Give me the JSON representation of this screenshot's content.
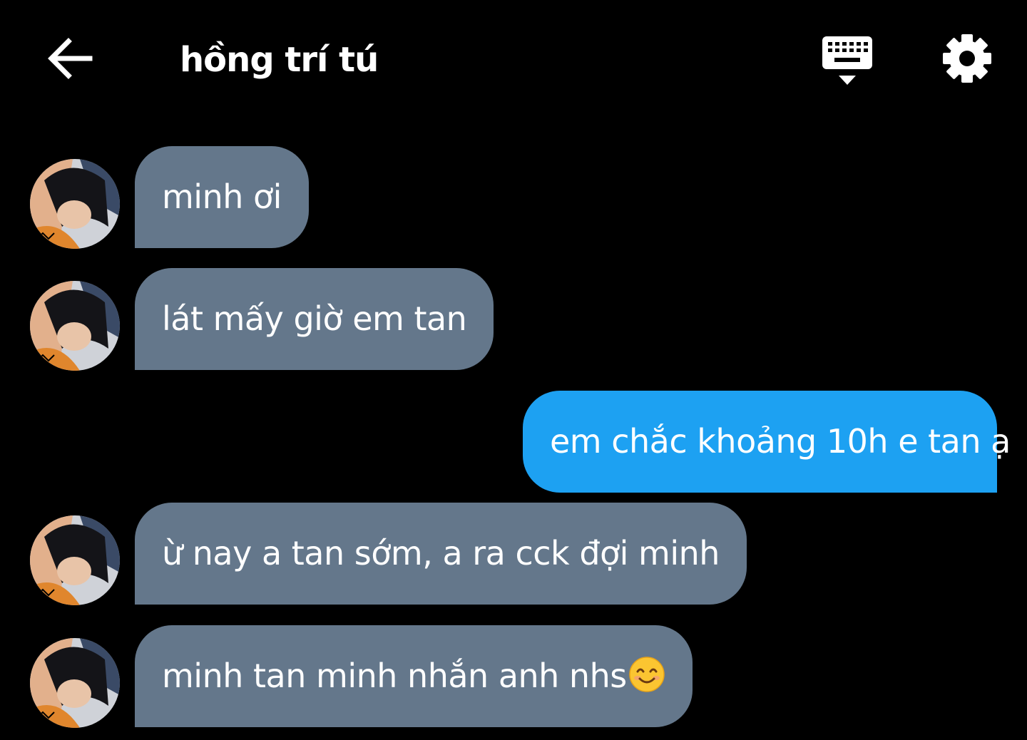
{
  "header": {
    "title": "hồng trí tú",
    "back_icon": "arrow-left-icon",
    "keyboard_icon": "keyboard-hide-icon",
    "settings_icon": "gear-icon"
  },
  "colors": {
    "background": "#000000",
    "incoming_bubble": "#64778b",
    "outgoing_bubble": "#1da1f2",
    "text": "#ffffff"
  },
  "messages": [
    {
      "direction": "incoming",
      "text": "minh ơi"
    },
    {
      "direction": "incoming",
      "text": "lát mấy giờ em tan"
    },
    {
      "direction": "outgoing",
      "text": "em chắc khoảng 10h e tan ạ"
    },
    {
      "direction": "incoming",
      "text": "ừ nay a tan sớm, a ra cck đợi minh"
    },
    {
      "direction": "incoming",
      "text": "minh tan minh nhắn anh nhs",
      "emoji": "smiling-face-emoji"
    }
  ]
}
